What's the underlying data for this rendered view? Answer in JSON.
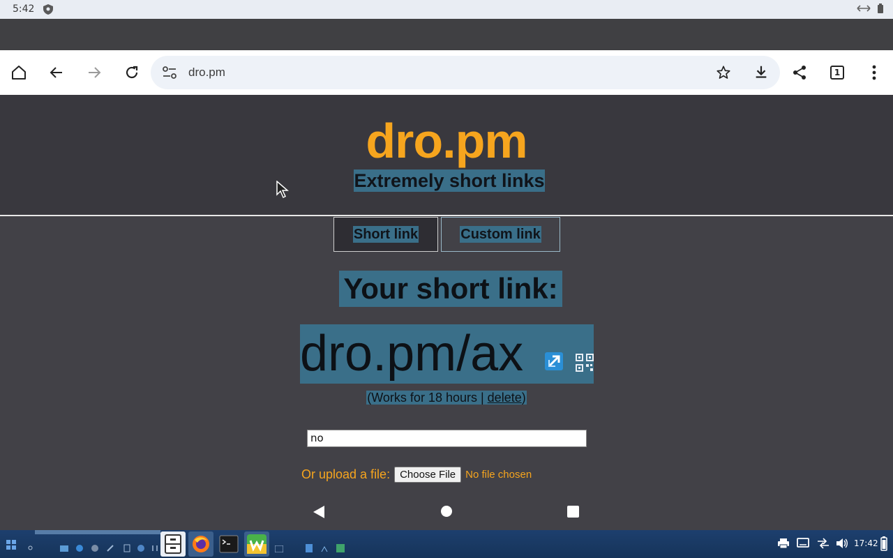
{
  "status_bar": {
    "time": "5:42"
  },
  "browser": {
    "url": "dro.pm",
    "tab_count": "1"
  },
  "page": {
    "logo": "dro.pm",
    "tagline": "Extremely short links",
    "tabs": [
      {
        "label": "Short link",
        "selected": true
      },
      {
        "label": "Custom link",
        "selected": false
      }
    ],
    "heading": "Your short link:",
    "short_link": "dro.pm/ax",
    "works_prefix": "(Works for 18 hours | ",
    "delete_label": "delete",
    "works_suffix": ")",
    "input_value": "no",
    "upload_label": "Or upload a file:",
    "choose_file_label": "Choose File",
    "no_file_label": "No file chosen"
  },
  "taskbar": {
    "clock": "17:42"
  },
  "colors": {
    "accent": "#f6a51e",
    "highlight": "#3a6f89",
    "page_bg": "#424147",
    "header_bg": "#39383e"
  },
  "icons": {
    "toolbar": [
      "home-icon",
      "back-icon",
      "forward-icon",
      "reload-icon",
      "site-settings-icon",
      "bookmark-star-icon",
      "download-icon",
      "share-icon",
      "tab-switcher-icon",
      "more-menu-icon"
    ],
    "page": [
      "open-link-icon",
      "qr-code-icon"
    ],
    "nav": [
      "nav-back-icon",
      "nav-home-icon",
      "nav-recents-icon"
    ]
  }
}
